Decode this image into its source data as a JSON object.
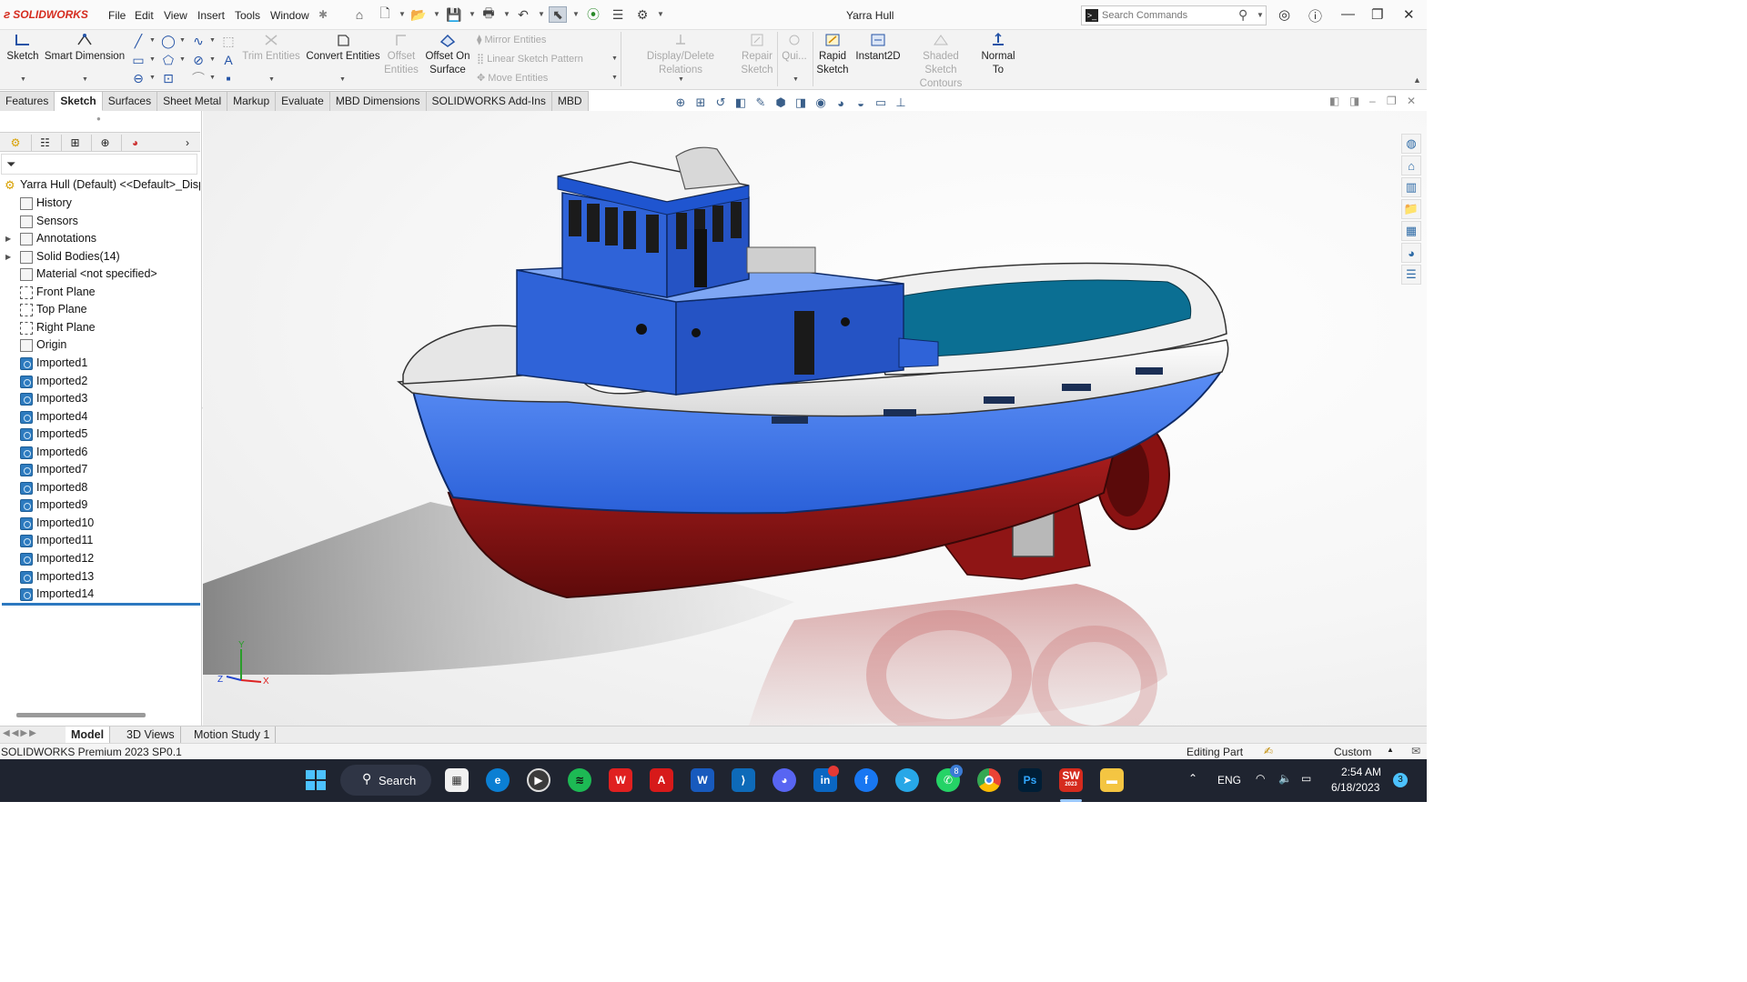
{
  "app": {
    "brand": "SOLIDWORKS",
    "document_title": "Yarra Hull",
    "brand_color": "#d52b1e",
    "accent_color": "#2c78c0"
  },
  "menu": {
    "items": [
      "File",
      "Edit",
      "View",
      "Insert",
      "Tools",
      "Window"
    ]
  },
  "search": {
    "placeholder": "Search Commands"
  },
  "commands": {
    "sketch": "Sketch",
    "smart_dimension": "Smart Dimension",
    "trim_entities": "Trim Entities",
    "convert_entities": "Convert Entities",
    "offset_entities": "Offset Entities",
    "offset_on_surface": "Offset On Surface",
    "mirror_entities": "Mirror Entities",
    "linear_sketch_pattern": "Linear Sketch Pattern",
    "move_entities": "Move Entities",
    "display_delete_relations": "Display/Delete Relations",
    "repair_sketch": "Repair Sketch",
    "quick_snaps": "Qui...",
    "rapid_sketch": "Rapid Sketch",
    "instant2d": "Instant2D",
    "shaded_sketch_contours": "Shaded Sketch Contours",
    "normal_to": "Normal To"
  },
  "tabs": [
    "Features",
    "Sketch",
    "Surfaces",
    "Sheet Metal",
    "Markup",
    "Evaluate",
    "MBD Dimensions",
    "SOLIDWORKS Add-Ins",
    "MBD"
  ],
  "active_tab": "Sketch",
  "tree": {
    "root": "Yarra Hull (Default) <<Default>_Disp",
    "items": [
      {
        "label": "History",
        "icon": "history-icon"
      },
      {
        "label": "Sensors",
        "icon": "sensors-icon"
      },
      {
        "label": "Annotations",
        "icon": "annotations-icon",
        "expandable": true
      },
      {
        "label": "Solid Bodies(14)",
        "icon": "solid-bodies-icon",
        "expandable": true
      },
      {
        "label": "Material <not specified>",
        "icon": "material-icon"
      },
      {
        "label": "Front Plane",
        "icon": "plane-icon"
      },
      {
        "label": "Top Plane",
        "icon": "plane-icon"
      },
      {
        "label": "Right Plane",
        "icon": "plane-icon"
      },
      {
        "label": "Origin",
        "icon": "origin-icon"
      },
      {
        "label": "Imported1",
        "icon": "imported-body-icon"
      },
      {
        "label": "Imported2",
        "icon": "imported-body-icon"
      },
      {
        "label": "Imported3",
        "icon": "imported-body-icon"
      },
      {
        "label": "Imported4",
        "icon": "imported-body-icon"
      },
      {
        "label": "Imported5",
        "icon": "imported-body-icon"
      },
      {
        "label": "Imported6",
        "icon": "imported-body-icon"
      },
      {
        "label": "Imported7",
        "icon": "imported-body-icon"
      },
      {
        "label": "Imported8",
        "icon": "imported-body-icon"
      },
      {
        "label": "Imported9",
        "icon": "imported-body-icon"
      },
      {
        "label": "Imported10",
        "icon": "imported-body-icon"
      },
      {
        "label": "Imported11",
        "icon": "imported-body-icon"
      },
      {
        "label": "Imported12",
        "icon": "imported-body-icon"
      },
      {
        "label": "Imported13",
        "icon": "imported-body-icon"
      },
      {
        "label": "Imported14",
        "icon": "imported-body-icon"
      }
    ]
  },
  "axes": {
    "y": "Y",
    "z": "Z",
    "x": "X"
  },
  "bottom_tabs": [
    "Model",
    "3D Views",
    "Motion Study 1"
  ],
  "status": {
    "product": "SOLIDWORKS Premium 2023 SP0.1",
    "mode": "Editing Part",
    "units": "Custom"
  },
  "taskbar": {
    "search_label": "Search",
    "language": "ENG",
    "time": "2:54 AM",
    "date": "6/18/2023",
    "notification_count": "3",
    "whatsapp_badge": "8",
    "sw_badge": "2023"
  },
  "model_colors": {
    "hull_upper": "#3b74e8",
    "hull_lower": "#8a1010",
    "bulwark": "#f2f2f2",
    "deck": "#0b6f93",
    "cabin": "#2f63d8"
  }
}
